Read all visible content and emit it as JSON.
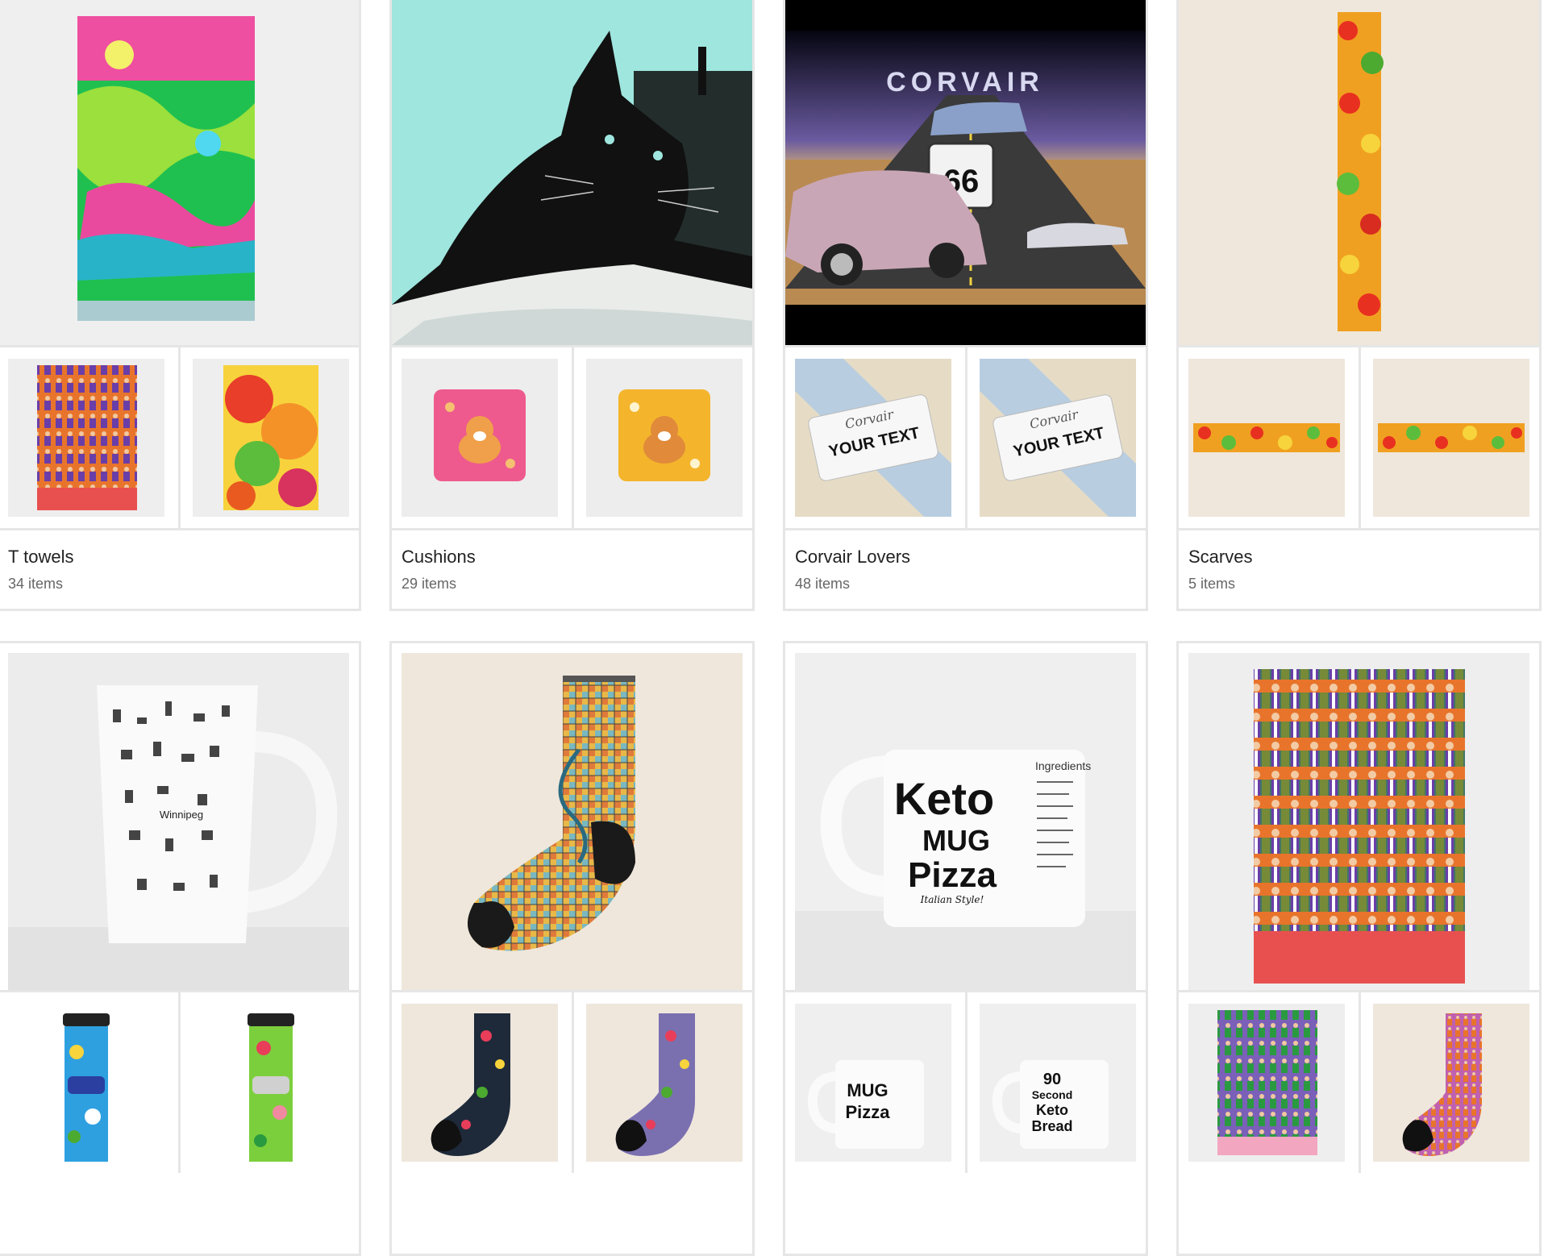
{
  "collections": [
    {
      "title": "T towels",
      "count": "34 items",
      "hero_icon": "graffiti-towel-image",
      "thumb_icons": [
        "people-pattern-towel-image",
        "watercolor-towel-image"
      ]
    },
    {
      "title": "Cushions",
      "count": "29 items",
      "hero_icon": "black-cat-image",
      "thumb_icons": [
        "corgi-pink-cushion-image",
        "corgi-yellow-cushion-image"
      ]
    },
    {
      "title": "Corvair Lovers",
      "count": "48 items",
      "hero_icon": "corvair-route-66-image",
      "thumb_icons": [
        "corvair-license-plate-image",
        "corvair-license-plate-image-2"
      ]
    },
    {
      "title": "Scarves",
      "count": "5 items",
      "hero_icon": "floral-scarf-image",
      "thumb_icons": [
        "floral-scarf-image-2",
        "floral-scarf-image-3"
      ]
    },
    {
      "hero_icon": "winnipeg-latte-mug-image",
      "thumb_icons": [
        "blue-car-tumbler-image",
        "green-car-tumbler-image"
      ]
    },
    {
      "hero_icon": "city-map-sock-image",
      "thumb_icons": [
        "floral-sock-image",
        "purple-sock-image"
      ]
    },
    {
      "hero_icon": "keto-mug-pizza-image",
      "thumb_icons": [
        "mug-pizza-mug-image",
        "keto-bread-mug-image"
      ]
    },
    {
      "hero_icon": "people-pattern-towel-image-large",
      "thumb_icons": [
        "people-pattern-towel-image-small",
        "people-pattern-sock-image"
      ]
    }
  ],
  "hero_texts": {
    "corvair_title": "CORVAIR",
    "route_number": "66",
    "plate_brand": "Corvair",
    "plate_text": "YOUR TEXT",
    "plate_text_2": "YOUR TEXT",
    "mug_word_1": "Keto",
    "mug_word_2": "MUG",
    "mug_word_3": "Pizza",
    "mug_tagline": "Italian Style!",
    "mug_side": "Ingredients",
    "winnipeg": "Winnipeg",
    "small_mug_1a": "MUG",
    "small_mug_1b": "Pizza",
    "small_mug_2a": "90",
    "small_mug_2b": "Second",
    "small_mug_2c": "Keto",
    "small_mug_2d": "Bread"
  },
  "colors": {
    "border": "#e6e6e6",
    "title": "#222222",
    "count": "#666666",
    "cat_bg": "#9fe6df",
    "photo_bg": "#eeeeee",
    "cream_bg": "#efe7dc"
  }
}
